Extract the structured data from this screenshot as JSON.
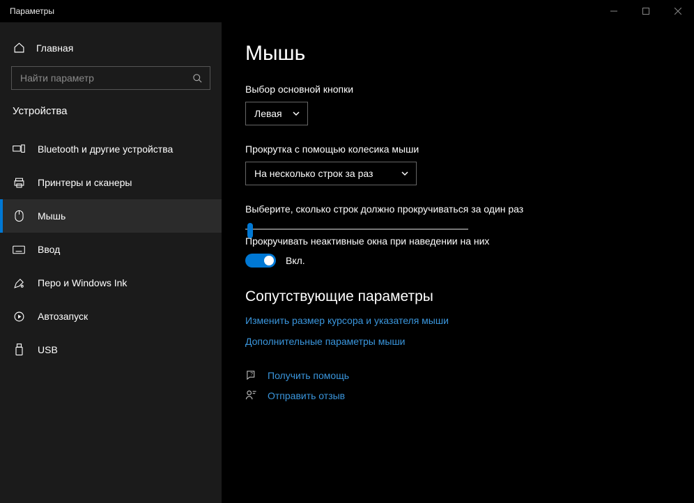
{
  "window": {
    "title": "Параметры"
  },
  "sidebar": {
    "home": "Главная",
    "search_placeholder": "Найти параметр",
    "category": "Устройства",
    "items": [
      {
        "label": "Bluetooth и другие устройства"
      },
      {
        "label": "Принтеры и сканеры"
      },
      {
        "label": "Мышь"
      },
      {
        "label": "Ввод"
      },
      {
        "label": "Перо и Windows Ink"
      },
      {
        "label": "Автозапуск"
      },
      {
        "label": "USB"
      }
    ]
  },
  "main": {
    "title": "Мышь",
    "primary_button": {
      "label": "Выбор основной кнопки",
      "value": "Левая"
    },
    "scroll_mode": {
      "label": "Прокрутка с помощью колесика мыши",
      "value": "На несколько строк за раз"
    },
    "lines_per_scroll": {
      "label": "Выберите, сколько строк должно прокручиваться за один раз"
    },
    "inactive_hover": {
      "label": "Прокручивать неактивные окна при наведении на них",
      "state": "Вкл."
    },
    "related": {
      "heading": "Сопутствующие параметры",
      "links": [
        "Изменить размер курсора и указателя мыши",
        "Дополнительные параметры мыши"
      ]
    },
    "help": {
      "get_help": "Получить помощь",
      "feedback": "Отправить отзыв"
    }
  }
}
